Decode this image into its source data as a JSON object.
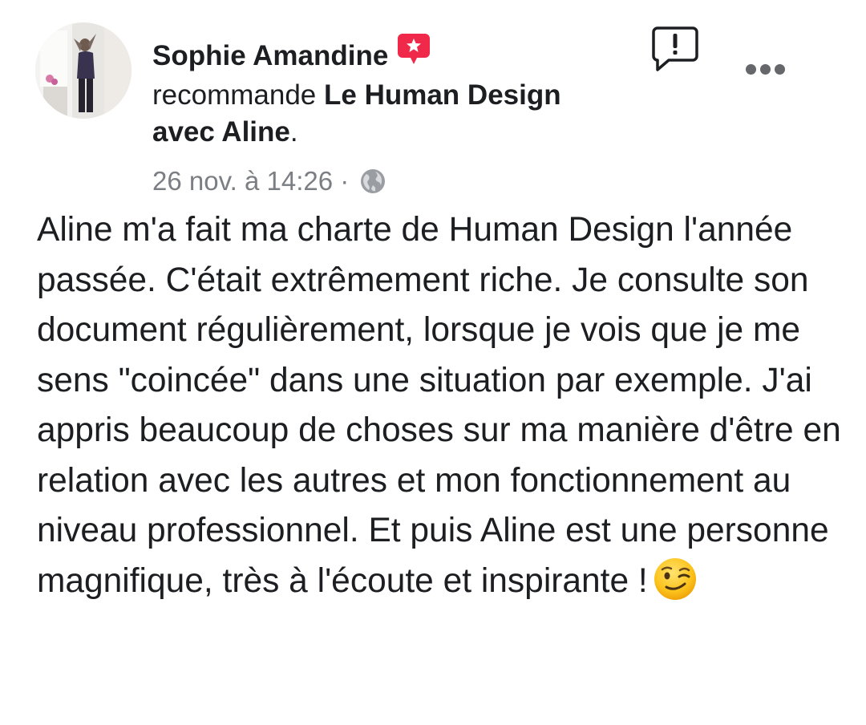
{
  "post": {
    "author": "Sophie Amandine",
    "recommend_verb": "recommande",
    "page_name": "Le Human Design avec Aline",
    "period": ".",
    "timestamp": "26 nov. à 14:26",
    "separator": "·",
    "privacy_icon": "globe-icon",
    "badge_icon": "recommendation-star-icon",
    "report_icon": "report-icon",
    "more_icon": "more-options-icon",
    "body": "Aline m'a fait ma charte de Human Design l'année passée. C'était extrêmement riche. Je consulte son document régulièrement, lorsque je vois que je me sens \"coincée\" dans une situation par exemple. J'ai appris beaucoup de choses sur ma manière d'être en relation avec les autres et mon fonctionnement au niveau professionnel. Et puis Aline est une personne magnifique, très à l'écoute et inspirante !",
    "emoji": "winking-face-emoji"
  },
  "colors": {
    "badge": "#f0284a",
    "meta_text": "#7b7e83",
    "body_text": "#1c1e21"
  }
}
